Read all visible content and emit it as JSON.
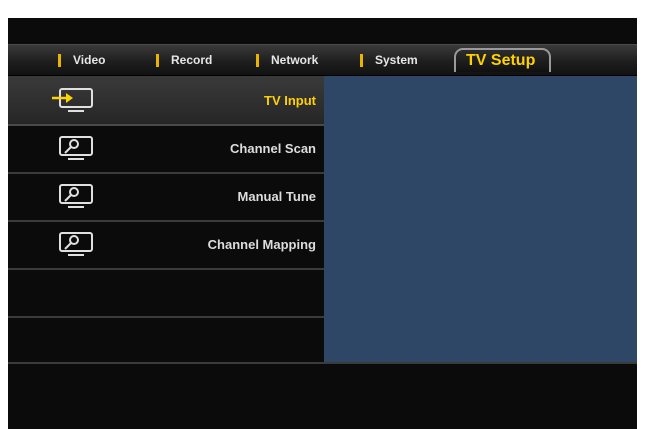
{
  "tabs": [
    {
      "label": "Video"
    },
    {
      "label": "Record"
    },
    {
      "label": "Network"
    },
    {
      "label": "System"
    },
    {
      "label": "TV Setup",
      "active": true
    }
  ],
  "menu": {
    "items": [
      {
        "label": "TV Input",
        "icon": "tv-input-icon",
        "selected": true
      },
      {
        "label": "Channel Scan",
        "icon": "tv-scan-icon"
      },
      {
        "label": "Manual Tune",
        "icon": "tv-scan-icon"
      },
      {
        "label": "Channel Mapping",
        "icon": "tv-scan-icon"
      }
    ]
  },
  "colors": {
    "accent": "#ffd100",
    "panel": "#2f4766",
    "tab_marker": "#e8b400"
  }
}
